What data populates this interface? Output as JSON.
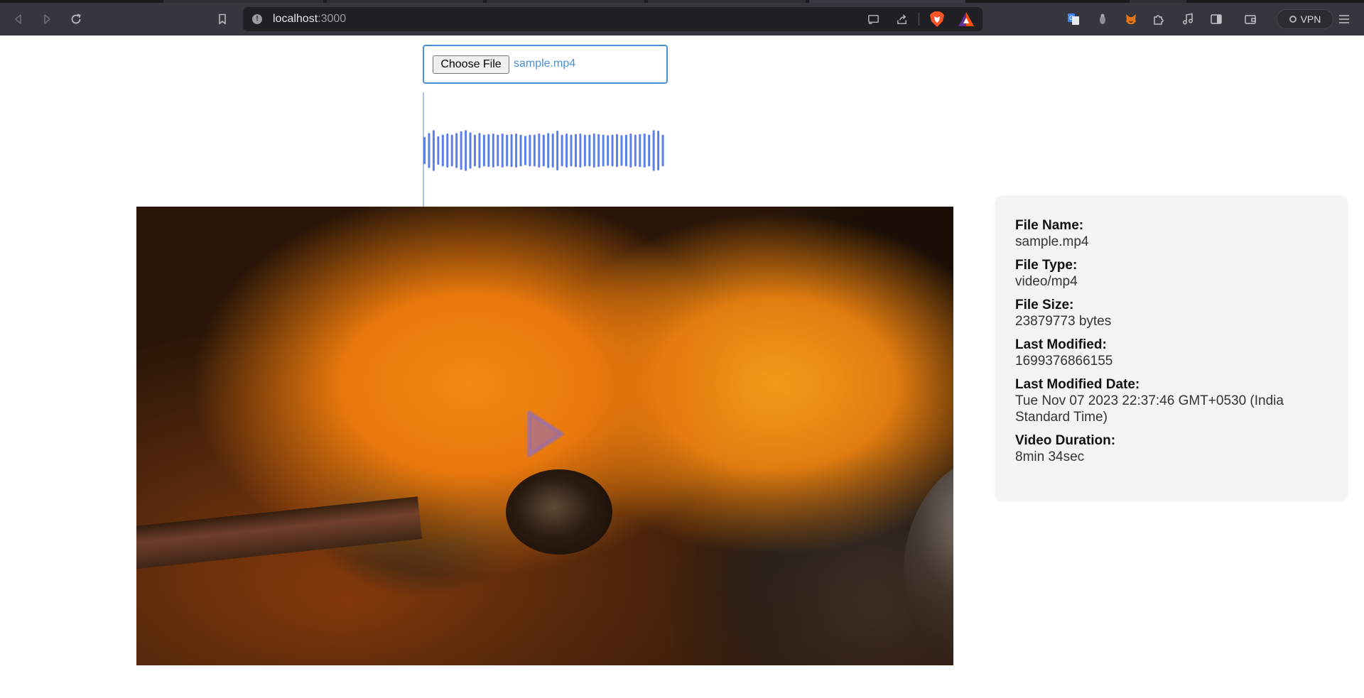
{
  "browser": {
    "url_host": "localhost",
    "url_port": ":3000",
    "vpn_label": "VPN"
  },
  "icons": {
    "back": "back-icon",
    "forward": "forward-icon",
    "reload": "reload-icon",
    "bookmark": "bookmark-icon",
    "site_info": "site-info-icon",
    "cast": "cast-icon",
    "share": "share-icon",
    "brave": "brave-shields-icon",
    "rewards": "brave-rewards-icon",
    "translate": "translate-icon",
    "extension_misc": "extension-icon",
    "metamask": "metamask-icon",
    "puzzle": "extensions-puzzle-icon",
    "media": "media-controls-icon",
    "sidebar": "sidebar-icon",
    "wallet": "wallet-icon",
    "menu": "menu-icon",
    "play": "play-icon"
  },
  "upload": {
    "button_label": "Choose File",
    "file_name": "sample.mp4"
  },
  "waveform": {
    "color": "#5b7fe8",
    "bars": [
      0.48,
      0.62,
      0.72,
      0.5,
      0.56,
      0.6,
      0.56,
      0.62,
      0.68,
      0.72,
      0.64,
      0.56,
      0.62,
      0.56,
      0.58,
      0.6,
      0.56,
      0.6,
      0.56,
      0.58,
      0.6,
      0.56,
      0.52,
      0.56,
      0.56,
      0.6,
      0.56,
      0.62,
      0.6,
      0.7,
      0.56,
      0.6,
      0.56,
      0.58,
      0.6,
      0.56,
      0.56,
      0.6,
      0.58,
      0.56,
      0.54,
      0.56,
      0.58,
      0.54,
      0.56,
      0.6,
      0.56,
      0.58,
      0.6,
      0.56,
      0.72,
      0.7,
      0.56
    ]
  },
  "file_info": {
    "items": [
      {
        "label": "File Name:",
        "value": "sample.mp4"
      },
      {
        "label": "File Type:",
        "value": "video/mp4"
      },
      {
        "label": "File Size:",
        "value": "23879773 bytes"
      },
      {
        "label": "Last Modified:",
        "value": "1699376866155"
      },
      {
        "label": "Last Modified Date:",
        "value": "Tue Nov 07 2023 22:37:46 GMT+0530 (India Standard Time)"
      },
      {
        "label": "Video Duration:",
        "value": "8min 34sec"
      }
    ]
  }
}
